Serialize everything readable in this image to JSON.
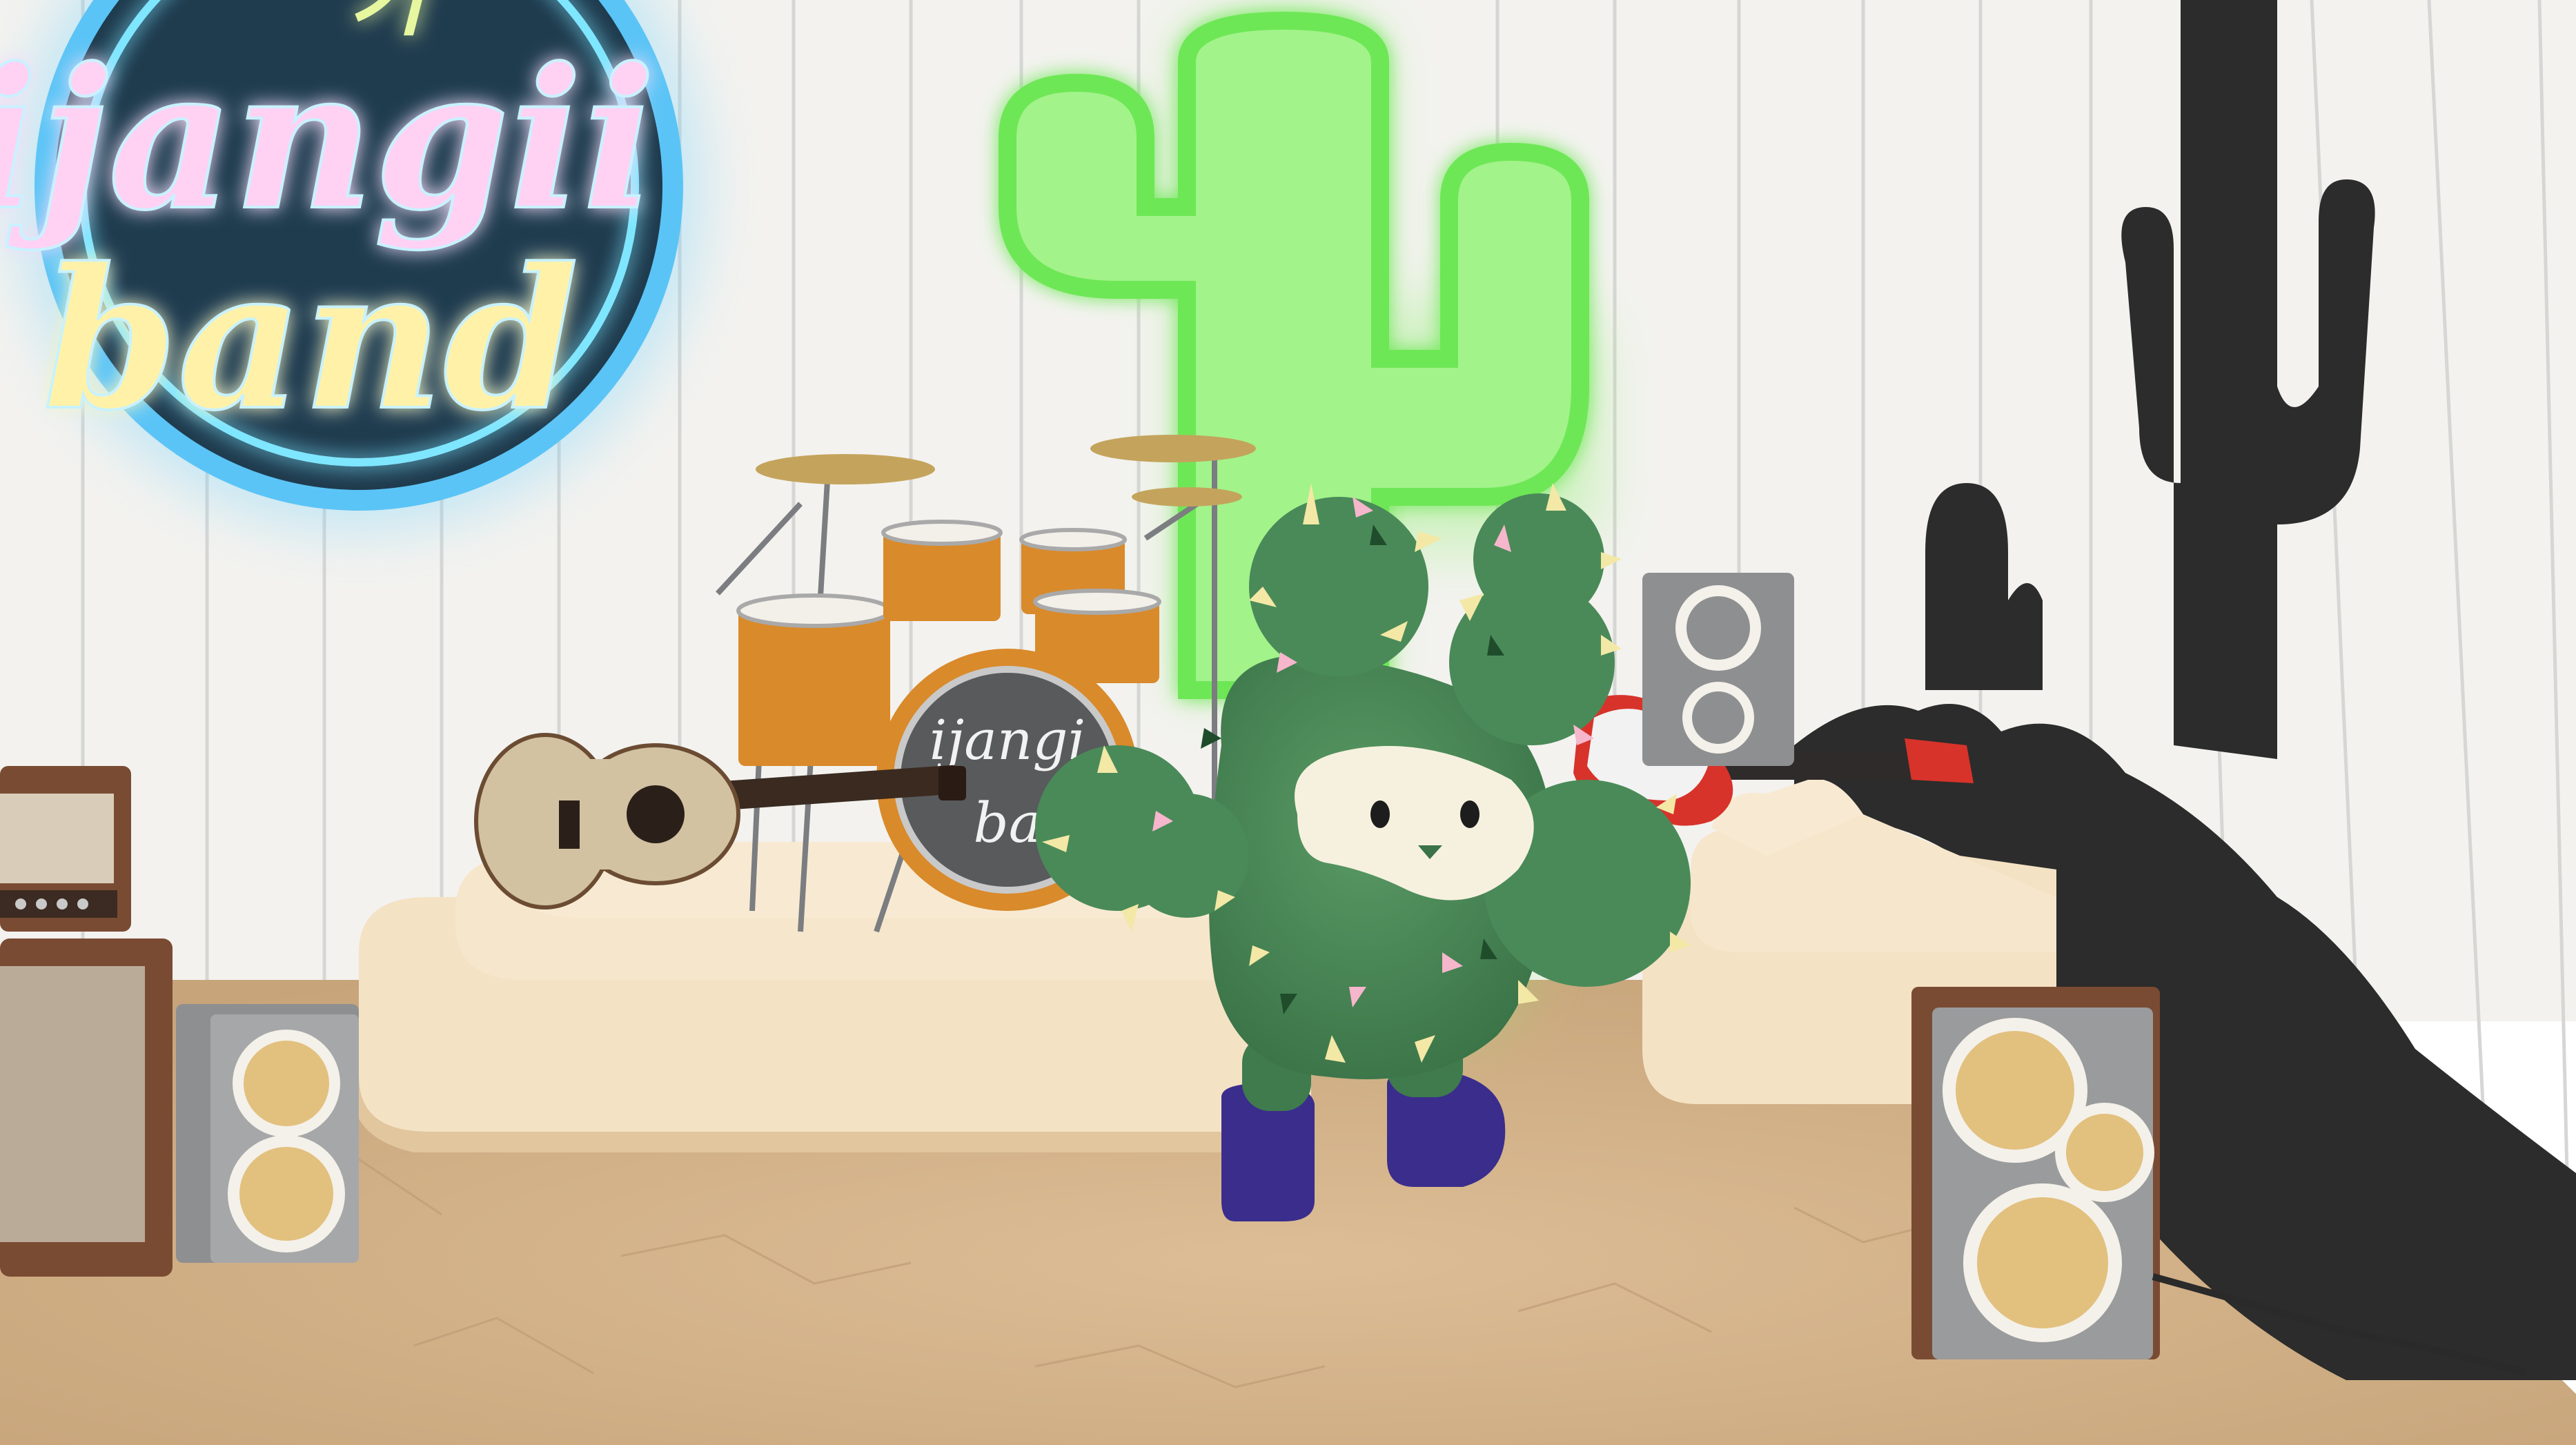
{
  "scene": {
    "neon_sign": {
      "line1": "ijangii",
      "line2": "band",
      "top_mark": "기"
    },
    "bass_drum_head": {
      "line1": "ijangi",
      "line2": "ba"
    }
  },
  "colors": {
    "wall": "#f3f2ef",
    "wall_plank_line": "#d8d8d6",
    "floor": "#d2b188",
    "stage": "#f4e2c4",
    "stage_edge": "#e6cea8",
    "cactus_body": "#4a8a58",
    "cactus_dark": "#3a7347",
    "face_patch": "#f6f1de",
    "shoes": "#3a2d8c",
    "neon_cactus": "#8cf06a",
    "neon_ring": "#6fd3ff",
    "drum_orange": "#d98a2b",
    "silhouette": "#2b2c2b",
    "speaker_body": "#8e8f90",
    "speaker_cone": "#e2c07e",
    "wood_speaker": "#7a4b33",
    "guitar_red": "#d7332b",
    "acoustic_wood": "#d2c2a2"
  },
  "icons": [
    "neon-sign-icon",
    "neon-cactus-icon",
    "drum-kit-icon",
    "acoustic-guitar-icon",
    "electric-guitar-icon",
    "speaker-icon",
    "amplifier-icon",
    "cactus-mascot-icon",
    "cactus-silhouette-icon"
  ]
}
